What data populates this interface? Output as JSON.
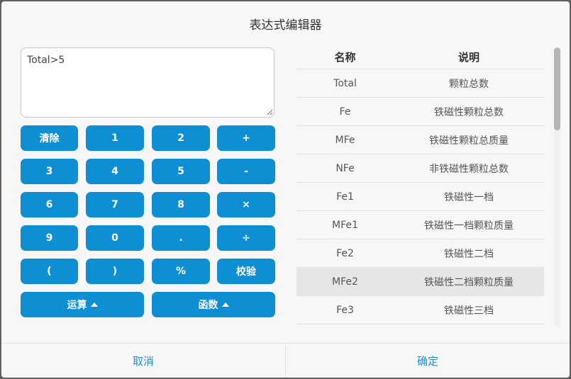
{
  "dialog": {
    "title": "表达式编辑器",
    "expression": "Total>5"
  },
  "keypad": {
    "clear": "清除",
    "k1": "1",
    "k2": "2",
    "plus": "+",
    "k3": "3",
    "k4": "4",
    "k5": "5",
    "minus": "-",
    "k6": "6",
    "k7": "7",
    "k8": "8",
    "multiply": "×",
    "k9": "9",
    "k0": "0",
    "dot": ".",
    "divide": "÷",
    "lparen": "(",
    "rparen": ")",
    "percent": "%",
    "validate": "校验",
    "operations": "运算",
    "functions": "函数"
  },
  "table": {
    "headers": [
      "名称",
      "说明"
    ],
    "rows": [
      {
        "name": "Total",
        "desc": "颗粒总数"
      },
      {
        "name": "Fe",
        "desc": "铁磁性颗粒总数"
      },
      {
        "name": "MFe",
        "desc": "铁磁性颗粒总质量"
      },
      {
        "name": "NFe",
        "desc": "非铁磁性颗粒总数"
      },
      {
        "name": "Fe1",
        "desc": "铁磁性一档"
      },
      {
        "name": "MFe1",
        "desc": "铁磁性一档颗粒质量"
      },
      {
        "name": "Fe2",
        "desc": "铁磁性二档"
      },
      {
        "name": "MFe2",
        "desc": "铁磁性二档颗粒质量"
      },
      {
        "name": "Fe3",
        "desc": "铁磁性三档"
      }
    ]
  },
  "footer": {
    "cancel": "取消",
    "confirm": "确定"
  }
}
